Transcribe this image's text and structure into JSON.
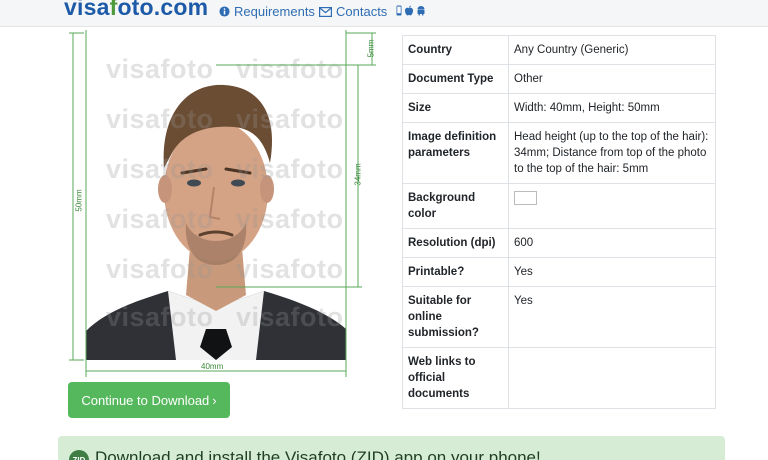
{
  "header": {
    "logo_main": "visa",
    "logo_accent": "f",
    "logo_rest": "oto.com",
    "nav_requirements": "Requirements",
    "nav_contacts": "Contacts"
  },
  "photo": {
    "watermark": "visafoto",
    "dim_height": "50mm",
    "dim_top": "5mm",
    "dim_head": "34mm",
    "dim_width": "40mm"
  },
  "actions": {
    "continue_label": "Continue to Download",
    "continue_icon": "›"
  },
  "details": [
    {
      "key": "Country",
      "value": "Any Country (Generic)"
    },
    {
      "key": "Document Type",
      "value": "Other"
    },
    {
      "key": "Size",
      "value": "Width: 40mm, Height: 50mm"
    },
    {
      "key": "Image definition parameters",
      "value": "Head height (up to the top of the hair): 34mm; Distance from top of the photo to the top of the hair: 5mm"
    },
    {
      "key": "Background color",
      "value": ""
    },
    {
      "key": "Resolution (dpi)",
      "value": "600"
    },
    {
      "key": "Printable?",
      "value": "Yes"
    },
    {
      "key": "Suitable for online submission?",
      "value": "Yes"
    },
    {
      "key": "Web links to official documents",
      "value": ""
    }
  ],
  "background_color_swatch": "#ffffff",
  "banner": {
    "icon_text": "ZID",
    "text": "Download and install the Visafoto (ZID) app on your phone!"
  },
  "colors": {
    "brand_blue": "#1d5aa8",
    "brand_green": "#55b85c",
    "dimension_green": "#3a8a3a"
  }
}
